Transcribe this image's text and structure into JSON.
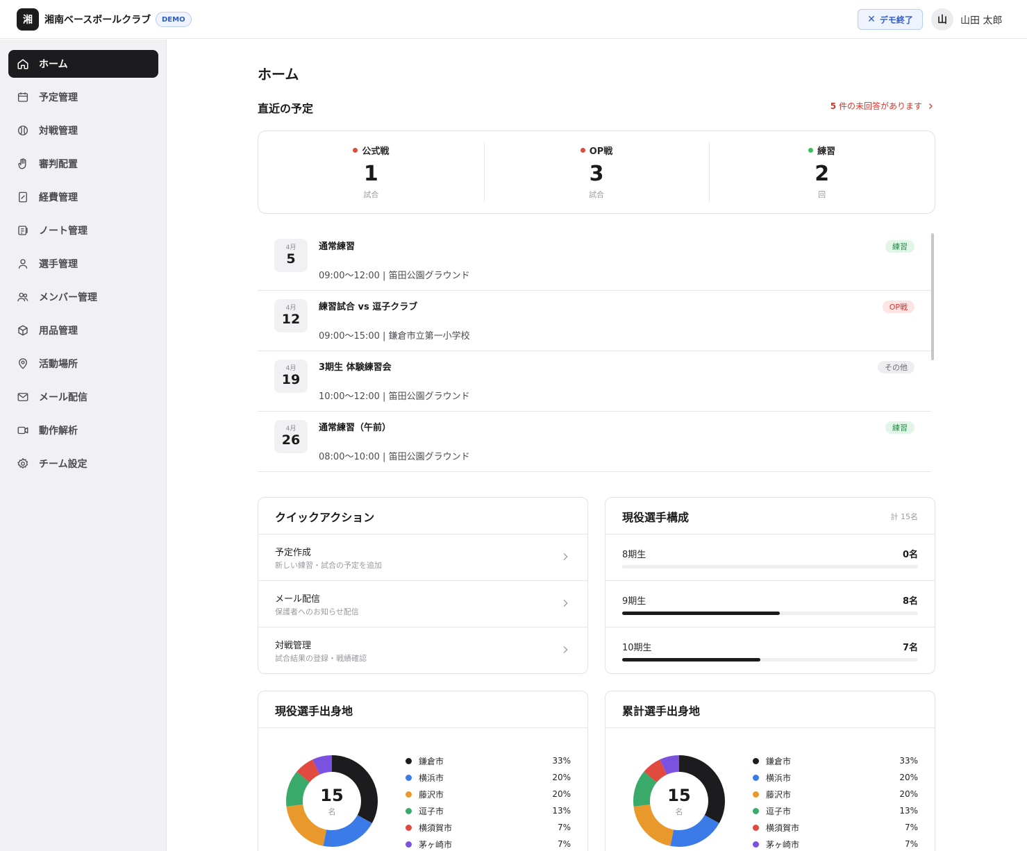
{
  "header": {
    "logo_char": "湘",
    "app_title": "湘南ベースボールクラブ",
    "demo_badge": "DEMO",
    "demo_end_label": "デモ終了",
    "avatar_char": "山",
    "user_name": "山田 太郎"
  },
  "sidebar": {
    "items": [
      {
        "label": "ホーム",
        "icon": "home-icon",
        "active": true
      },
      {
        "label": "予定管理",
        "icon": "calendar-icon"
      },
      {
        "label": "対戦管理",
        "icon": "baseball-icon"
      },
      {
        "label": "審判配置",
        "icon": "hand-icon"
      },
      {
        "label": "経費管理",
        "icon": "receipt-icon"
      },
      {
        "label": "ノート管理",
        "icon": "notebook-icon"
      },
      {
        "label": "選手管理",
        "icon": "user-icon"
      },
      {
        "label": "メンバー管理",
        "icon": "users-icon"
      },
      {
        "label": "用品管理",
        "icon": "box-icon"
      },
      {
        "label": "活動場所",
        "icon": "map-pin-icon"
      },
      {
        "label": "メール配信",
        "icon": "mail-icon"
      },
      {
        "label": "動作解析",
        "icon": "video-icon"
      },
      {
        "label": "チーム設定",
        "icon": "gear-icon"
      }
    ]
  },
  "main": {
    "page_title": "ホーム",
    "upcoming_title": "直近の予定",
    "unanswered_count": "5",
    "unanswered_text": "件の未回答があります",
    "stats": [
      {
        "label": "公式戦",
        "value": "1",
        "unit": "試合",
        "color": "#e04a3f"
      },
      {
        "label": "OP戦",
        "value": "3",
        "unit": "試合",
        "color": "#e04a3f"
      },
      {
        "label": "練習",
        "value": "2",
        "unit": "回",
        "color": "#3bbf5c"
      }
    ],
    "events": [
      {
        "month": "4月",
        "day": "5",
        "title": "通常練習",
        "detail": "09:00〜12:00 | 笛田公園グラウンド",
        "tag": "練習",
        "tag_style": "green"
      },
      {
        "month": "4月",
        "day": "12",
        "title": "練習試合 vs 逗子クラブ",
        "detail": "09:00〜15:00 | 鎌倉市立第一小学校",
        "tag": "OP戦",
        "tag_style": "red"
      },
      {
        "month": "4月",
        "day": "19",
        "title": "3期生 体験練習会",
        "detail": "10:00〜12:00 | 笛田公園グラウンド",
        "tag": "その他",
        "tag_style": "gray"
      },
      {
        "month": "4月",
        "day": "26",
        "title": "通常練習（午前）",
        "detail": "08:00〜10:00 | 笛田公園グラウンド",
        "tag": "練習",
        "tag_style": "green"
      }
    ],
    "quick_actions": {
      "title": "クイックアクション",
      "items": [
        {
          "title": "予定作成",
          "sub": "新しい練習・試合の予定を追加"
        },
        {
          "title": "メール配信",
          "sub": "保護者へのお知らせ配信"
        },
        {
          "title": "対戦管理",
          "sub": "試合結果の登録・戦績確認"
        }
      ]
    },
    "composition": {
      "title": "現役選手構成",
      "total": "計 15名",
      "items": [
        {
          "label": "8期生",
          "count": "0名",
          "fraction": 0.0
        },
        {
          "label": "9期生",
          "count": "8名",
          "fraction": 0.533
        },
        {
          "label": "10期生",
          "count": "7名",
          "fraction": 0.467
        }
      ]
    },
    "origin_current": {
      "title": "現役選手出身地",
      "center_value": "15",
      "center_unit": "名"
    },
    "origin_total": {
      "title": "累計選手出身地",
      "center_value": "15",
      "center_unit": "名"
    }
  },
  "chart_data": [
    {
      "type": "pie",
      "title": "現役選手出身地",
      "categories": [
        "鎌倉市",
        "横浜市",
        "藤沢市",
        "逗子市",
        "横須賀市",
        "茅ヶ崎市"
      ],
      "values": [
        33,
        20,
        20,
        13,
        7,
        7
      ],
      "colors": [
        "#1c1c1e",
        "#3b7be8",
        "#e9992b",
        "#3aaa6b",
        "#e04a3f",
        "#7b52e0"
      ]
    },
    {
      "type": "pie",
      "title": "累計選手出身地",
      "categories": [
        "鎌倉市",
        "横浜市",
        "藤沢市",
        "逗子市",
        "横須賀市",
        "茅ヶ崎市"
      ],
      "values": [
        33,
        20,
        20,
        13,
        7,
        7
      ],
      "colors": [
        "#1c1c1e",
        "#3b7be8",
        "#e9992b",
        "#3aaa6b",
        "#e04a3f",
        "#7b52e0"
      ]
    }
  ]
}
